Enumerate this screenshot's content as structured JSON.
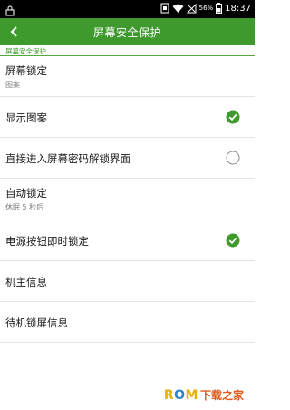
{
  "status_bar": {
    "battery_percent": "56%",
    "time": "18:37"
  },
  "action_bar": {
    "title": "屏幕安全保护"
  },
  "section": {
    "header": "屏幕安全保护"
  },
  "settings": [
    {
      "title": "屏幕锁定",
      "summary": "图案"
    },
    {
      "title": "显示图案",
      "checked": true
    },
    {
      "title": "直接进入屏幕密码解锁界面",
      "checked": false
    },
    {
      "title": "自动锁定",
      "summary": "休眠 5 秒后"
    },
    {
      "title": "电源按钮即时锁定",
      "checked": true
    },
    {
      "title": "机主信息"
    },
    {
      "title": "待机锁屏信息"
    }
  ],
  "watermark": {
    "brand_r": "R",
    "brand_o": "O",
    "brand_m": "M",
    "suffix": "下载之家"
  },
  "colors": {
    "accent": "#3f9a2e",
    "check_fill": "#3f9a2e"
  }
}
